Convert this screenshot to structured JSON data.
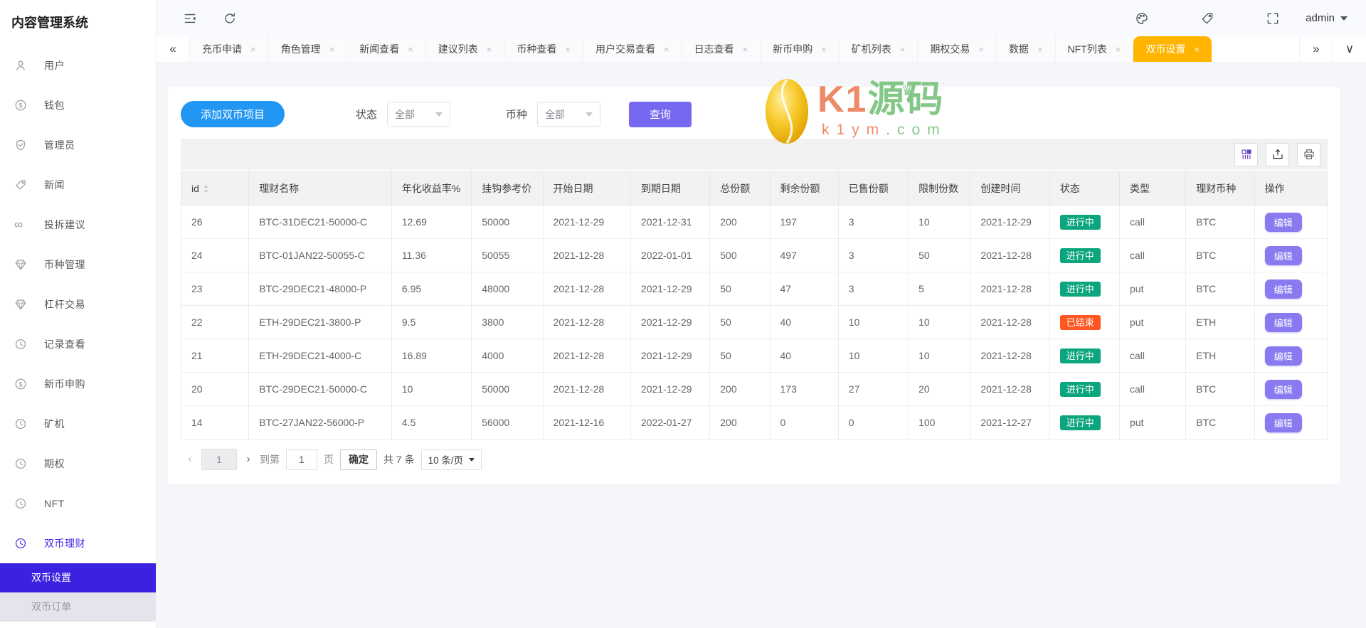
{
  "app": {
    "title": "内容管理系统"
  },
  "topbar": {
    "icons": [
      "collapse-icon",
      "refresh-icon"
    ],
    "right_icons": [
      "palette-icon",
      "tag-icon",
      "fullscreen-icon"
    ],
    "user": "admin"
  },
  "sidebar": {
    "items": [
      {
        "label": "用户",
        "icon": "user-icon",
        "active": false
      },
      {
        "label": "钱包",
        "icon": "dollar-icon",
        "active": false
      },
      {
        "label": "管理员",
        "icon": "shield-icon",
        "active": false
      },
      {
        "label": "新闻",
        "icon": "tag-icon",
        "active": false
      },
      {
        "label": "投拆建议",
        "icon": "infinity-icon",
        "active": false
      },
      {
        "label": "币种管理",
        "icon": "gem-icon",
        "active": false
      },
      {
        "label": "杠杆交易",
        "icon": "gem-icon",
        "active": false
      },
      {
        "label": "记录查看",
        "icon": "history-icon",
        "active": false
      },
      {
        "label": "新币申购",
        "icon": "dollar-icon",
        "active": false
      },
      {
        "label": "矿机",
        "icon": "history-icon",
        "active": false
      },
      {
        "label": "期权",
        "icon": "history-icon",
        "active": false
      },
      {
        "label": "NFT",
        "icon": "history-icon",
        "active": false
      },
      {
        "label": "双币理财",
        "icon": "history-icon",
        "active": true
      }
    ],
    "submenu": [
      {
        "label": "双币设置",
        "selected": true
      },
      {
        "label": "双币订单",
        "selected": false
      }
    ]
  },
  "tabs": {
    "items": [
      {
        "label": "充币申请",
        "active": false
      },
      {
        "label": "角色管理",
        "active": false
      },
      {
        "label": "新闻查看",
        "active": false
      },
      {
        "label": "建议列表",
        "active": false
      },
      {
        "label": "币种查看",
        "active": false
      },
      {
        "label": "用户交易查看",
        "active": false
      },
      {
        "label": "日志查看",
        "active": false
      },
      {
        "label": "新币申购",
        "active": false
      },
      {
        "label": "矿机列表",
        "active": false
      },
      {
        "label": "期权交易",
        "active": false
      },
      {
        "label": "数据",
        "active": false
      },
      {
        "label": "NFT列表",
        "active": false
      },
      {
        "label": "双币设置",
        "active": true
      }
    ]
  },
  "filters": {
    "add_button": "添加双币项目",
    "status_label": "状态",
    "status_value": "全部",
    "coin_label": "币种",
    "coin_value": "全部",
    "query_button": "查询"
  },
  "table_toolbar": {
    "icons": [
      "columns-icon",
      "export-icon",
      "print-icon"
    ]
  },
  "table": {
    "columns": [
      "id",
      "理财名称",
      "年化收益率%",
      "挂钩参考价",
      "开始日期",
      "到期日期",
      "总份额",
      "剩余份额",
      "已售份额",
      "限制份数",
      "创建时间",
      "状态",
      "类型",
      "理财币种",
      "操作"
    ],
    "edit_label": "编辑",
    "rows": [
      {
        "id": "26",
        "name": "BTC-31DEC21-50000-C",
        "rate": "12.69",
        "ref_price": "50000",
        "start": "2021-12-29",
        "end": "2021-12-31",
        "total": "200",
        "remain": "197",
        "sold": "3",
        "limit": "10",
        "created": "2021-12-29",
        "status": "进行中",
        "status_type": "ongoing",
        "type": "call",
        "coin": "BTC"
      },
      {
        "id": "24",
        "name": "BTC-01JAN22-50055-C",
        "rate": "11.36",
        "ref_price": "50055",
        "start": "2021-12-28",
        "end": "2022-01-01",
        "total": "500",
        "remain": "497",
        "sold": "3",
        "limit": "50",
        "created": "2021-12-28",
        "status": "进行中",
        "status_type": "ongoing",
        "type": "call",
        "coin": "BTC"
      },
      {
        "id": "23",
        "name": "BTC-29DEC21-48000-P",
        "rate": "6.95",
        "ref_price": "48000",
        "start": "2021-12-28",
        "end": "2021-12-29",
        "total": "50",
        "remain": "47",
        "sold": "3",
        "limit": "5",
        "created": "2021-12-28",
        "status": "进行中",
        "status_type": "ongoing",
        "type": "put",
        "coin": "BTC"
      },
      {
        "id": "22",
        "name": "ETH-29DEC21-3800-P",
        "rate": "9.5",
        "ref_price": "3800",
        "start": "2021-12-28",
        "end": "2021-12-29",
        "total": "50",
        "remain": "40",
        "sold": "10",
        "limit": "10",
        "created": "2021-12-28",
        "status": "已结束",
        "status_type": "ended",
        "type": "put",
        "coin": "ETH"
      },
      {
        "id": "21",
        "name": "ETH-29DEC21-4000-C",
        "rate": "16.89",
        "ref_price": "4000",
        "start": "2021-12-28",
        "end": "2021-12-29",
        "total": "50",
        "remain": "40",
        "sold": "10",
        "limit": "10",
        "created": "2021-12-28",
        "status": "进行中",
        "status_type": "ongoing",
        "type": "call",
        "coin": "ETH"
      },
      {
        "id": "20",
        "name": "BTC-29DEC21-50000-C",
        "rate": "10",
        "ref_price": "50000",
        "start": "2021-12-28",
        "end": "2021-12-29",
        "total": "200",
        "remain": "173",
        "sold": "27",
        "limit": "20",
        "created": "2021-12-28",
        "status": "进行中",
        "status_type": "ongoing",
        "type": "call",
        "coin": "BTC"
      },
      {
        "id": "14",
        "name": "BTC-27JAN22-56000-P",
        "rate": "4.5",
        "ref_price": "56000",
        "start": "2021-12-16",
        "end": "2022-01-27",
        "total": "200",
        "remain": "0",
        "sold": "0",
        "limit": "100",
        "created": "2021-12-27",
        "status": "进行中",
        "status_type": "ongoing",
        "type": "put",
        "coin": "BTC"
      }
    ]
  },
  "pagination": {
    "prev": "‹",
    "current": "1",
    "next": "›",
    "goto_label": "到第",
    "page_value": "1",
    "page_label": "页",
    "confirm": "确定",
    "total": "共 7 条",
    "per_page": "10 条/页"
  },
  "watermark": {
    "brand_left": "K1",
    "brand_right": "源码",
    "crown": "♛",
    "site_left": "k1ym.",
    "site_right": "com"
  },
  "colors": {
    "sidebar_selected_bg": "#3b21e0",
    "sidebar_active_text": "#4527e9",
    "tab_active_bg": "#ffb400",
    "add_button": "#2196f3",
    "query_button": "#7668f0",
    "edit_button": "#8a7af0",
    "badge_ongoing": "#0ba57e",
    "badge_ended": "#ff5722"
  }
}
